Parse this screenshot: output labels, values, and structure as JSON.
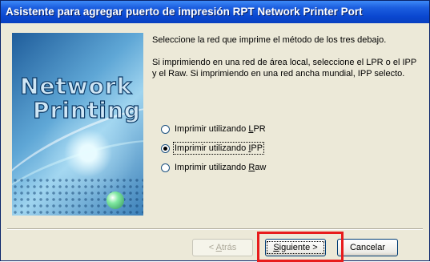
{
  "window": {
    "title": "Asistente para agregar puerto de impresión RPT Network Printer Port"
  },
  "banner": {
    "line1": "Network",
    "line2": "Printing"
  },
  "instructions": {
    "para1": "Seleccione la red que imprime el método de los tres debajo.",
    "para2": "Si imprimiendo en una red de área local, seleccione el LPR o el IPP y el Raw.  Si imprimiendo en una red ancha mundial, IPP selecto."
  },
  "options": [
    {
      "prefix": "Imprimir utilizando ",
      "key": "L",
      "suffix": "PR",
      "checked": false
    },
    {
      "prefix": "Imprimir utilizando ",
      "key": "I",
      "suffix": "PP",
      "checked": true
    },
    {
      "prefix": "Imprimir utilizando ",
      "key": "R",
      "suffix": "aw",
      "checked": false
    }
  ],
  "buttons": {
    "back": {
      "prefix": "< ",
      "key": "A",
      "suffix": "trás",
      "enabled": false
    },
    "next": {
      "key": "S",
      "suffix": "iguiente >"
    },
    "cancel": "Cancelar"
  },
  "colors": {
    "titlebar": "#0a47d0",
    "highlight": "#e81c1c"
  }
}
